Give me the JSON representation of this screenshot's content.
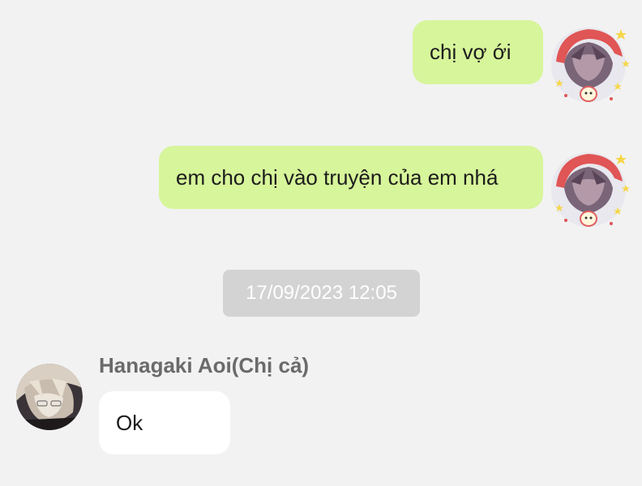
{
  "messages": [
    {
      "direction": "sent",
      "text": "chị vợ ới",
      "avatar": "anime-avatar-red-hood-icon"
    },
    {
      "direction": "sent",
      "text": "em cho chị vào truyện của em nhá",
      "avatar": "anime-avatar-red-hood-icon"
    }
  ],
  "timestamp": "17/09/2023 12:05",
  "received": {
    "sender_name": "Hanagaki Aoi(Chị cả)",
    "text": "Ok",
    "avatar": "anime-avatar-blonde-icon"
  },
  "colors": {
    "background": "#f2f2f2",
    "sent_bubble": "#d7f59a",
    "received_bubble": "#ffffff",
    "timestamp_bg": "#d3d3d3",
    "sender_name": "#6a6a6a"
  }
}
